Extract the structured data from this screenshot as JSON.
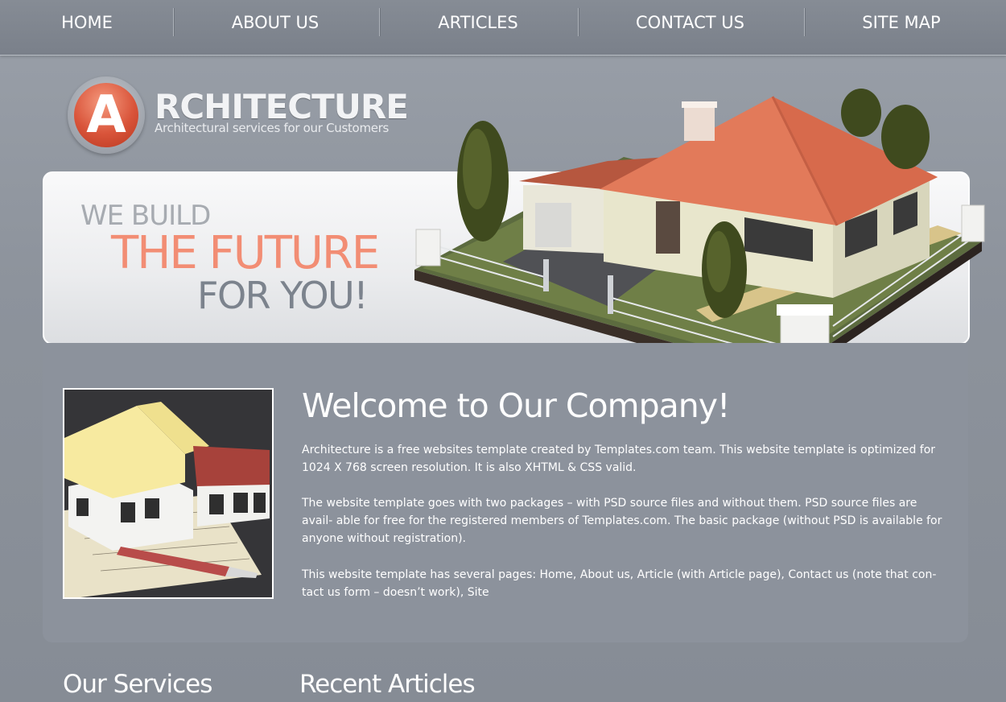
{
  "nav": {
    "items": [
      {
        "label": "HOME"
      },
      {
        "label": "ABOUT US"
      },
      {
        "label": "ARTICLES"
      },
      {
        "label": "CONTACT US"
      },
      {
        "label": "SITE MAP"
      }
    ]
  },
  "logo": {
    "letter": "A",
    "title": "RCHITECTURE",
    "subtitle": "Architectural services for our Customers",
    "accent_color": "#d9543a"
  },
  "banner": {
    "line1": "WE BUILD",
    "line2": "THE FUTURE",
    "line3": "FOR YOU!",
    "image": "house-illustration"
  },
  "main": {
    "image": "house-model-with-blueprints-and-pen",
    "title": "Welcome to Our Company!",
    "paragraphs": [
      "Architecture is a free websites template created by Templates.com team. This website template is optimized for 1024 X 768 screen resolution. It is also XHTML & CSS valid.",
      "The website template goes with two packages – with PSD source files and without them. PSD source files are avail- able for free for the registered members of Templates.com. The basic package (without PSD is available for anyone without registration).",
      "This website template has several pages: Home, About us, Article (with Article page), Contact us (note that con-tact us form – doesn’t work), Site"
    ]
  },
  "sections": {
    "services_title": "Our Services",
    "articles_title": "Recent Articles"
  },
  "colors": {
    "nav_bg": "#7f858f",
    "page_bg": "#8d939c",
    "highlight": "#f28d74",
    "dark_text": "#7c838d"
  }
}
